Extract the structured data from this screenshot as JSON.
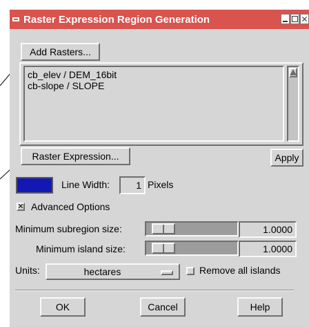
{
  "window": {
    "title": "Raster Expression Region Generation"
  },
  "buttons": {
    "add_rasters": "Add Rasters...",
    "raster_expression": "Raster Expression...",
    "apply": "Apply",
    "ok": "OK",
    "cancel": "Cancel",
    "help": "Help"
  },
  "raster_list": {
    "items": [
      "cb_elev / DEM_16bit",
      "cb-slope / SLOPE"
    ]
  },
  "line_width": {
    "label": "Line Width:",
    "value": "1",
    "unit": "Pixels"
  },
  "advanced_options": {
    "label": "Advanced Options",
    "checked": true
  },
  "min_subregion": {
    "label": "Minimum subregion size:",
    "value": "1.0000"
  },
  "min_island": {
    "label": "Minimum island size:",
    "value": "1.0000"
  },
  "units": {
    "label": "Units:",
    "value": "hectares"
  },
  "remove_islands": {
    "label": "Remove all islands",
    "checked": false
  },
  "colors": {
    "title_bar": "#d9534f",
    "line_color_swatch": "#1218b4",
    "window_bg": "#d6d6d6"
  }
}
